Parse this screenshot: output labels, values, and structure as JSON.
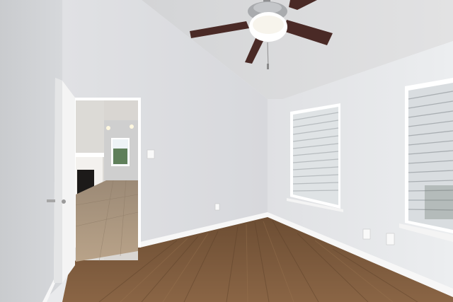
{
  "scene": {
    "kind": "empty-bedroom-interior",
    "icons": [
      "ceiling-fan-icon",
      "window-blinds-icon",
      "open-door-icon",
      "fireplace-icon",
      "outlet-icon",
      "light-switch-icon"
    ],
    "colors": {
      "ceiling": "#dcdcdc",
      "wall_left": "#d5d7da",
      "wall_back": "#e3e4e6",
      "wall_right": "#e8e9ec",
      "floor": "#7a5a3d",
      "baseboard": "#f6f6f6",
      "door": "#f2f2f2",
      "fan_blade": "#4a2a26",
      "tile_floor": "#b09a80"
    }
  }
}
